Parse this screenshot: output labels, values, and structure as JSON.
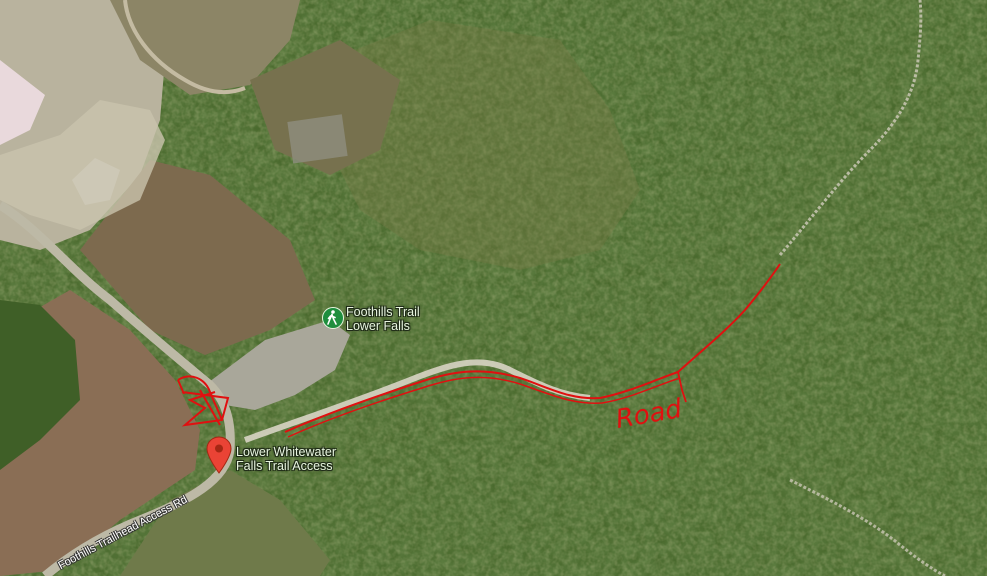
{
  "places": [
    {
      "name_line1": "Foothills Trail",
      "name_line2": "Lower Falls",
      "icon": "hiking-icon"
    },
    {
      "name_line1": "Lower Whitewater",
      "name_line2": "Falls Trail Access",
      "icon": "red-map-pin-icon"
    }
  ],
  "roads": [
    {
      "name": "Foothills Trailhead Access Rd"
    }
  ],
  "annotation": {
    "text": "Road",
    "color": "#e01010"
  },
  "colors": {
    "forest": "#4a6a2e",
    "pin": "#ea4335",
    "hike_badge": "#1e8e3e",
    "drawing": "#e01010"
  }
}
